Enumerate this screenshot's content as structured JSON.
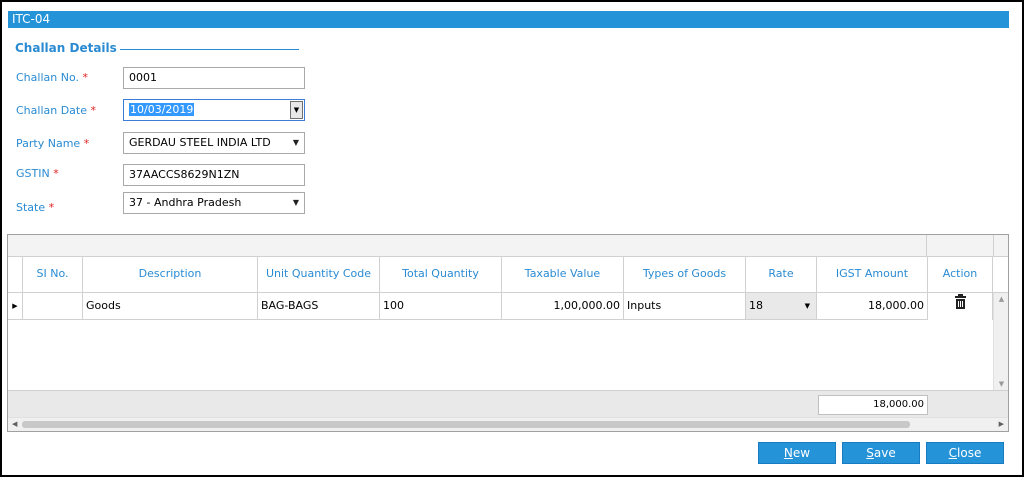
{
  "window": {
    "title": "ITC-04"
  },
  "section": {
    "title": "Challan Details"
  },
  "form": {
    "challan_no": {
      "label": "Challan No.",
      "value": "0001"
    },
    "challan_date": {
      "label": "Challan Date",
      "value": "10/03/2019"
    },
    "party_name": {
      "label": "Party Name",
      "value": "GERDAU STEEL INDIA LTD"
    },
    "gstin": {
      "label": "GSTIN",
      "value": "37AACCS8629N1ZN"
    },
    "state": {
      "label": "State",
      "value": "37 - Andhra Pradesh"
    },
    "required_mark": "*"
  },
  "grid": {
    "columns": [
      "SI No.",
      "Description",
      "Unit Quantity Code",
      "Total Quantity",
      "Taxable Value",
      "Types of Goods",
      "Rate",
      "IGST Amount",
      "Action"
    ],
    "rows": [
      {
        "si_no": "",
        "description": "Goods",
        "unit_quantity_code": "BAG-BAGS",
        "total_quantity": "100",
        "taxable_value": "1,00,000.00",
        "types_of_goods": "Inputs",
        "rate": "18",
        "igst_amount": "18,000.00",
        "action_icon": "trash-icon"
      }
    ],
    "total_igst": "18,000.00"
  },
  "buttons": {
    "new": {
      "first": "N",
      "rest": "ew"
    },
    "save": {
      "first": "S",
      "rest": "ave"
    },
    "close": {
      "first": "C",
      "rest": "lose"
    }
  },
  "colors": {
    "accent": "#2593d8",
    "label": "#2a8bd3",
    "required": "#e02020"
  }
}
